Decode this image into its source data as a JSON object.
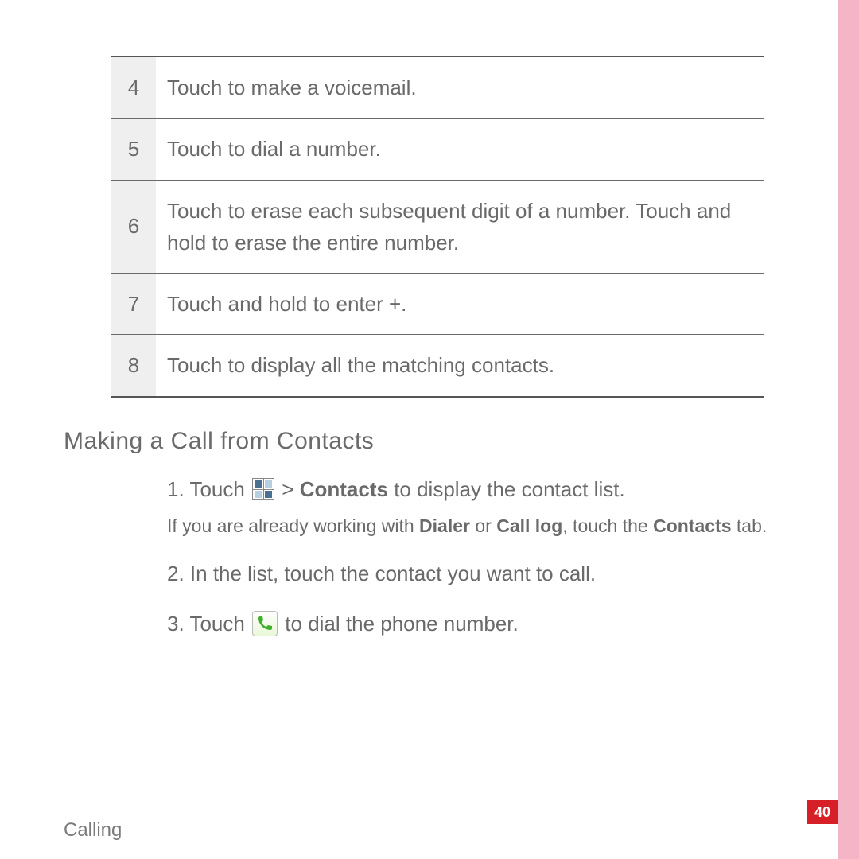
{
  "table": {
    "rows": [
      {
        "num": "4",
        "desc": "Touch to make a voicemail."
      },
      {
        "num": "5",
        "desc": "Touch to dial a number."
      },
      {
        "num": "6",
        "desc": "Touch to erase each subsequent digit of a number. Touch and hold to erase the entire number."
      },
      {
        "num": "7",
        "desc": "Touch and hold to enter +."
      },
      {
        "num": "8",
        "desc": "Touch to display all the matching contacts."
      }
    ]
  },
  "section_heading": "Making a Call from Contacts",
  "steps": {
    "s1_prefix": "1. Touch ",
    "s1_gt": " > ",
    "s1_bold": "Contacts",
    "s1_suffix": " to display the contact list.",
    "s1_sub_a": "If you are already working with ",
    "s1_sub_b1": "Dialer",
    "s1_sub_or": " or ",
    "s1_sub_b2": "Call log",
    "s1_sub_c": ", touch the ",
    "s1_sub_b3": "Contacts",
    "s1_sub_d": " tab.",
    "s2": "2. In the list, touch the contact you want to call.",
    "s3_prefix": "3. Touch ",
    "s3_suffix": " to dial the phone number."
  },
  "footer": "Calling",
  "page_number": "40"
}
